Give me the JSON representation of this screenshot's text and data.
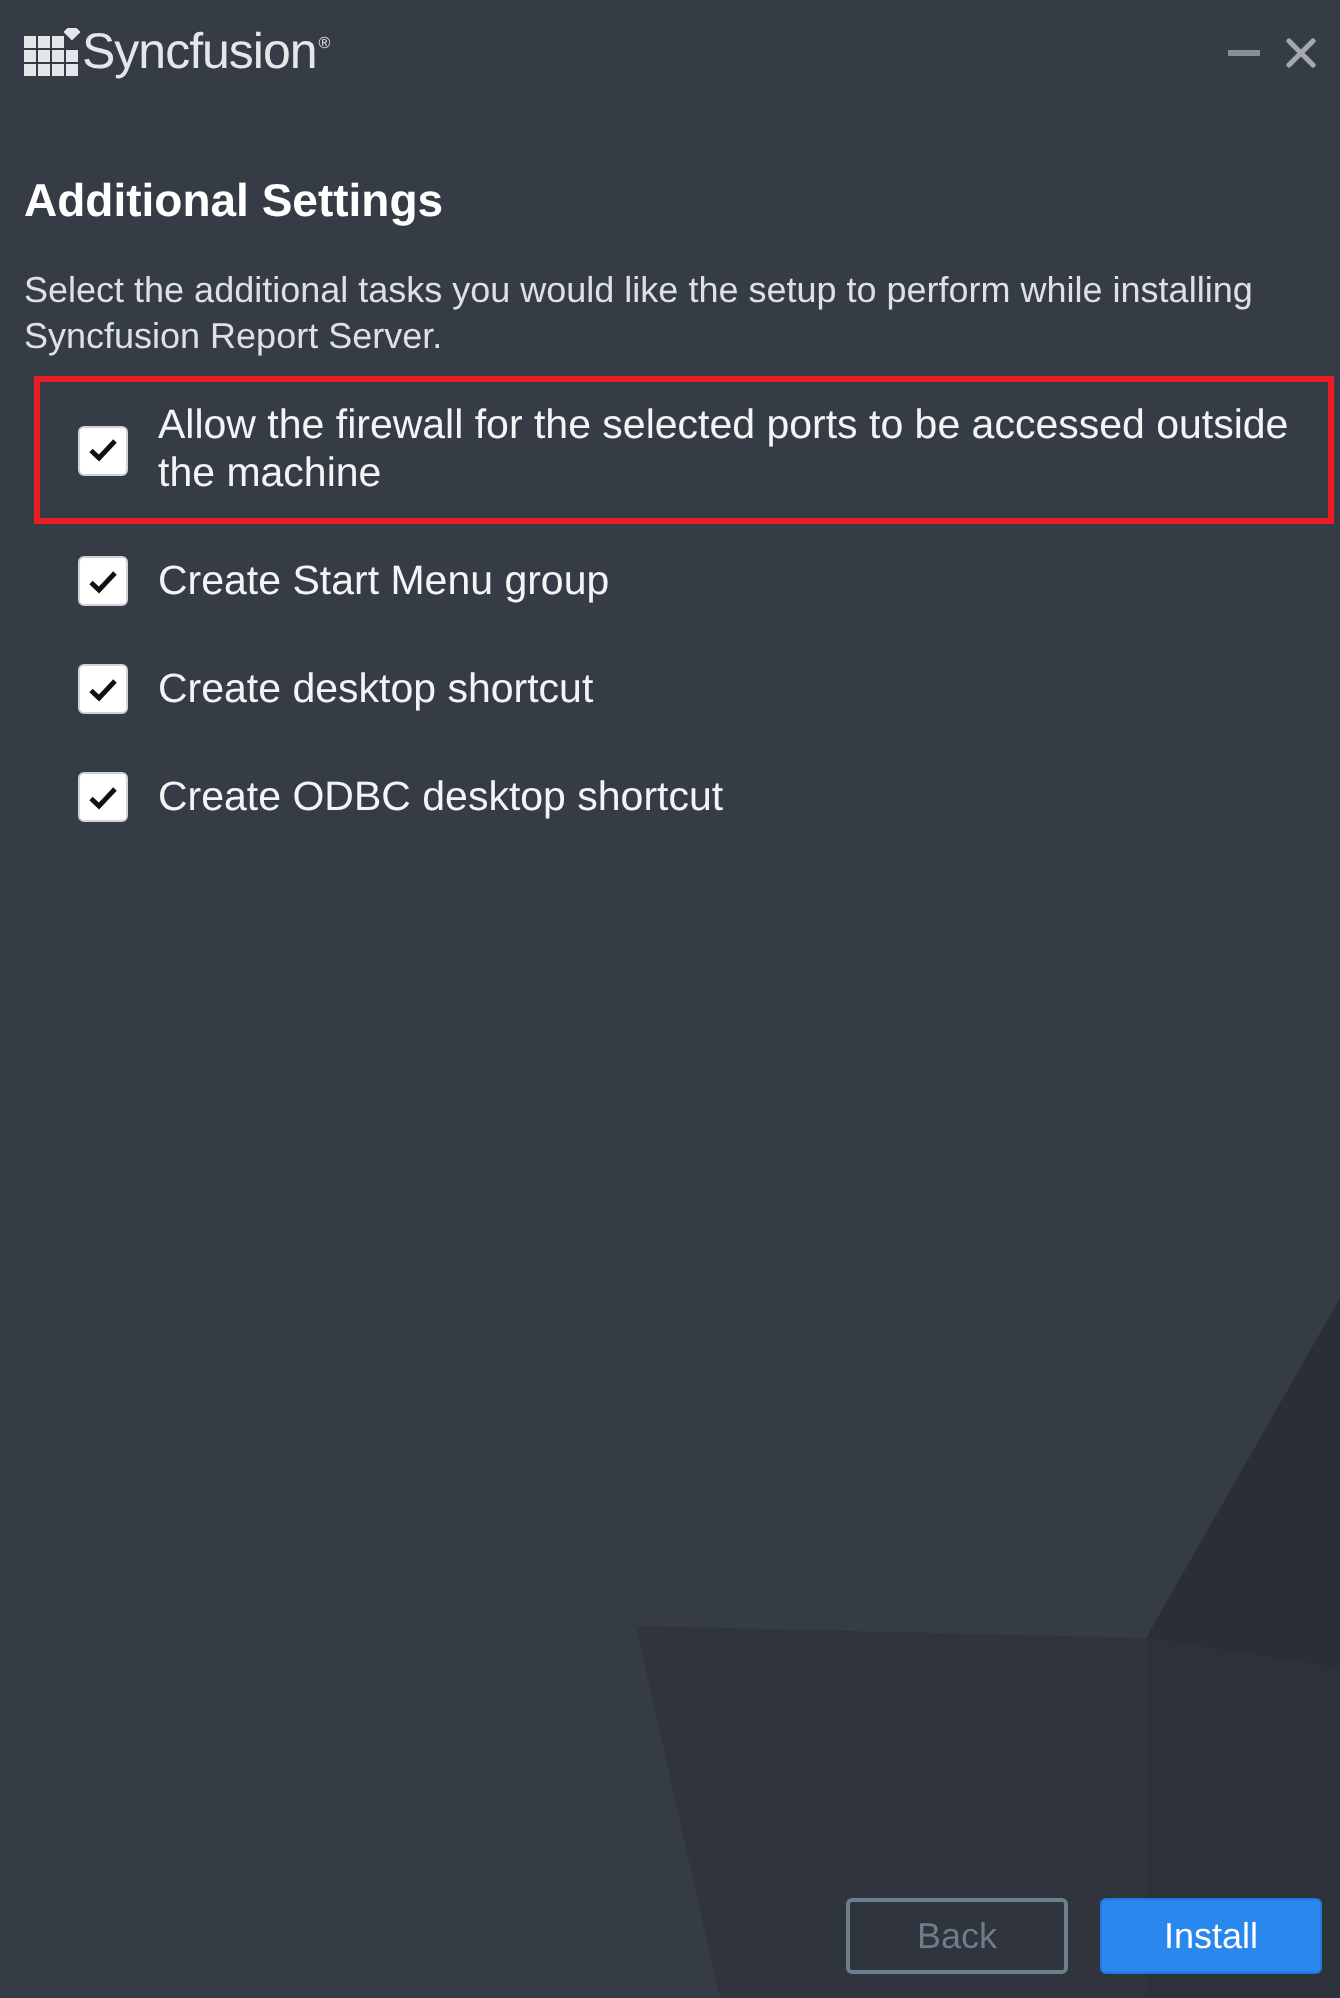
{
  "window": {
    "logo": {
      "text": "Syncfusion",
      "mark": "®"
    },
    "controls": [
      {
        "kind": "minimize"
      },
      {
        "kind": "close"
      }
    ]
  },
  "page": {
    "title": "Additional Settings",
    "description": "Select the additional tasks you would like the setup to perform while installing Syncfusion Report Server."
  },
  "options": [
    {
      "label": "Allow the firewall for the selected ports to be accessed outside the machine",
      "checked": true,
      "highlighted": true
    },
    {
      "label": "Create Start Menu group",
      "checked": true,
      "highlighted": false
    },
    {
      "label": "Create desktop shortcut",
      "checked": true,
      "highlighted": false
    },
    {
      "label": "Create ODBC desktop shortcut",
      "checked": true,
      "highlighted": false
    }
  ],
  "buttons": [
    {
      "label": "Back",
      "kind": "secondary",
      "disabled": true
    },
    {
      "label": "Install",
      "kind": "primary",
      "disabled": false
    }
  ]
}
